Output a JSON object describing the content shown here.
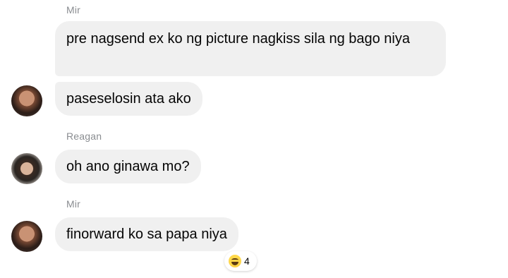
{
  "messages": [
    {
      "sender": "Mir",
      "text": "pre nagsend ex ko ng picture nagkiss sila ng bago niya"
    },
    {
      "text": "paseselosin ata ako"
    },
    {
      "sender": "Reagan",
      "text": "oh ano ginawa mo?"
    },
    {
      "sender": "Mir",
      "text": "finorward ko sa papa niya"
    }
  ],
  "reaction": {
    "icon": "laughing-face-icon",
    "count": "4"
  },
  "colors": {
    "bubble": "#f0f0f0",
    "sender_name": "#8a8d91",
    "text": "#050505"
  }
}
